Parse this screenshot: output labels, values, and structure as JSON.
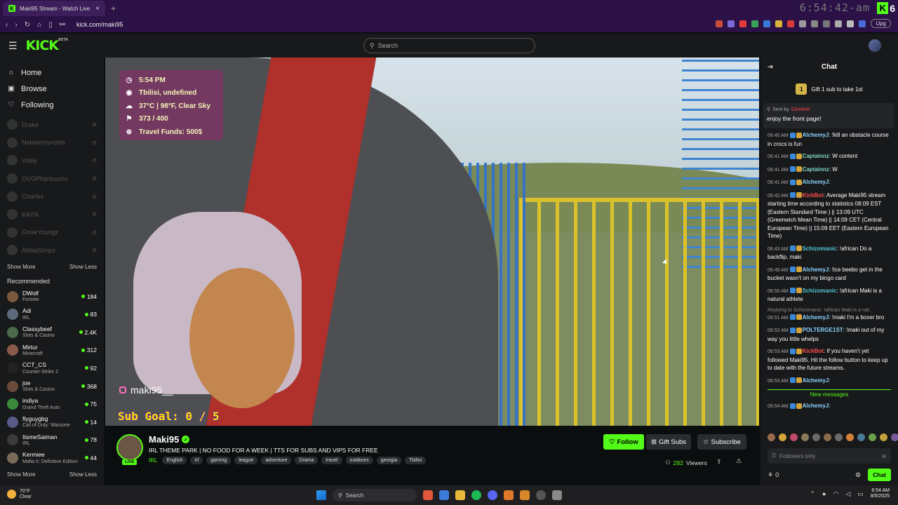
{
  "browser": {
    "tab_title": "Maki95 Stream - Watch Live ...",
    "tab_close": "×",
    "new_tab": "+",
    "clock_overlay": "6:54:42-am",
    "badge_letter": "K",
    "badge_number": "6",
    "url": "kick.com/maki95",
    "upgrade_label": "Upg"
  },
  "topnav": {
    "logo": "KICK",
    "logo_beta": "BETA",
    "search_placeholder": "Search"
  },
  "sidebar": {
    "nav": [
      {
        "label": "Home",
        "icon": "home-icon"
      },
      {
        "label": "Browse",
        "icon": "browse-icon"
      },
      {
        "label": "Following",
        "icon": "heart-icon"
      }
    ],
    "following": [
      "Drake",
      "Natalieroynolds",
      "Vitaly",
      "OVOPhantuums",
      "Charles",
      "KAYN",
      "OmarYoungz",
      "AbbieSimps"
    ],
    "show_more": "Show More",
    "show_less": "Show Less",
    "recommended_title": "Recommended",
    "recommended": [
      {
        "name": "DWolf",
        "category": "Fortnite",
        "viewers": "184",
        "color": "#7a5a3a"
      },
      {
        "name": "Adi",
        "category": "IRL",
        "viewers": "83",
        "color": "#5a6a7a"
      },
      {
        "name": "Classybeef",
        "category": "Slots & Casino",
        "viewers": "2.4K",
        "color": "#4a6a4a"
      },
      {
        "name": "Mirtur",
        "category": "Minecraft",
        "viewers": "312",
        "color": "#8a5a4a"
      },
      {
        "name": "CCT_CS",
        "category": "Counter-Strike 2",
        "viewers": "92",
        "color": "#222222"
      },
      {
        "name": "joe",
        "category": "Slots & Casino",
        "viewers": "368",
        "color": "#6a4a3a"
      },
      {
        "name": "indiya",
        "category": "Grand Theft Auto",
        "viewers": "75",
        "color": "#3a8a3a"
      },
      {
        "name": "flyguygbg",
        "category": "Call of Duty: Warzone",
        "viewers": "14",
        "color": "#5a5a8a"
      },
      {
        "name": "ItsmeSaiman",
        "category": "IRL",
        "viewers": "78",
        "color": "#3a3a3a"
      },
      {
        "name": "Kermiee",
        "category": "Mafia II: Definitive Edition",
        "viewers": "44",
        "color": "#7a6a5a"
      }
    ]
  },
  "overlay": {
    "time": "5:54 PM",
    "location": "Tbilisi, undefined",
    "weather": "37°C | 98°F, Clear Sky",
    "count": "373 / 400",
    "funds": "Travel Funds: 500$",
    "instagram": "maki95__",
    "sub_goal": "Sub Goal:  0 / 5"
  },
  "stream": {
    "name": "Maki95",
    "live": "LIVE",
    "title": "IRL THEME PARK | NO FOOD FOR A WEEK | TTS FOR SUBS AND VIPS FOR FREE",
    "category": "IRL",
    "tags": [
      "English",
      "Irl",
      "gaming",
      "league",
      "adventure",
      "Drama",
      "travel",
      "outdoors",
      "georgia",
      "Tbilisi"
    ],
    "follow": "Follow",
    "gift_subs": "Gift Subs",
    "subscribe": "Subscribe",
    "viewers": "282",
    "viewers_label": "Viewers"
  },
  "chat": {
    "title": "Chat",
    "gift_num": "1",
    "gift_text": "Gift 1 sub to take 1st",
    "pinned_sent": "Sent by",
    "pinned_user": "GinekeK",
    "pinned_msg": "enjoy the front page!",
    "messages": [
      {
        "time": "06:40 AM",
        "user": "AlchemyJ",
        "color": "#8ad4ff",
        "text": ": !kill an obstacle course in crocs is fun"
      },
      {
        "time": "06:41 AM",
        "user": "Captainnz",
        "color": "#7ed6c6",
        "text": ": W content"
      },
      {
        "time": "06:41 AM",
        "user": "Captainnz",
        "color": "#7ed6c6",
        "text": ": W"
      },
      {
        "time": "06:41 AM",
        "user": "AlchemyJ",
        "color": "#8ad4ff",
        "text": ":"
      },
      {
        "time": "06:42 AM",
        "user": "KickBot",
        "color": "#ff4b4b",
        "text": ": Average Maki95 stream starting time according to statistics 08:09 EST (Eastern Standard Time ) || 13:09 UTC (Greenwich Mean Time) || 14:09 CET (Central European Time) || 15:09 EET (Eastern European Time)"
      },
      {
        "time": "06:43 AM",
        "user": "Schizomanic",
        "color": "#53c6d6",
        "text": ": !african Do a backflip, maki"
      },
      {
        "time": "06:45 AM",
        "user": "AlchemyJ",
        "color": "#8ad4ff",
        "text": ": !ice beebo get in the bucket wasn't on my bingo card"
      },
      {
        "time": "06:50 AM",
        "user": "Schizomanic",
        "color": "#53c6d6",
        "text": ": !african Maki is a natural athlete"
      },
      {
        "time": "06:51 AM",
        "user": "AlchemyJ",
        "color": "#8ad4ff",
        "text": ": !maki I'm a boxer bro",
        "reply": "Replying to Schizomanic: !african Maki is a nat..."
      },
      {
        "time": "06:52 AM",
        "user": "POLTERGE1ST",
        "color": "#8ad4ff",
        "text": ": !maki out of my way you little whelps"
      },
      {
        "time": "06:53 AM",
        "user": "KickBot",
        "color": "#ff4b4b",
        "text": ": If you haven't yet followed Maki95. Hit the follow button to keep up to date with the future streams."
      },
      {
        "time": "06:53 AM",
        "user": "AlchemyJ",
        "color": "#8ad4ff",
        "text": ":"
      }
    ],
    "new_messages": "New messages",
    "last_message": {
      "time": "06:54 AM",
      "user": "AlchemyJ",
      "color": "#8ad4ff",
      "text": ":"
    },
    "input_placeholder": "Followers only",
    "points": "0",
    "chat_button": "Chat"
  },
  "taskbar": {
    "temp": "70°F",
    "condition": "Clear",
    "search": "Search",
    "time": "6:54 AM",
    "date": "8/5/2025"
  }
}
